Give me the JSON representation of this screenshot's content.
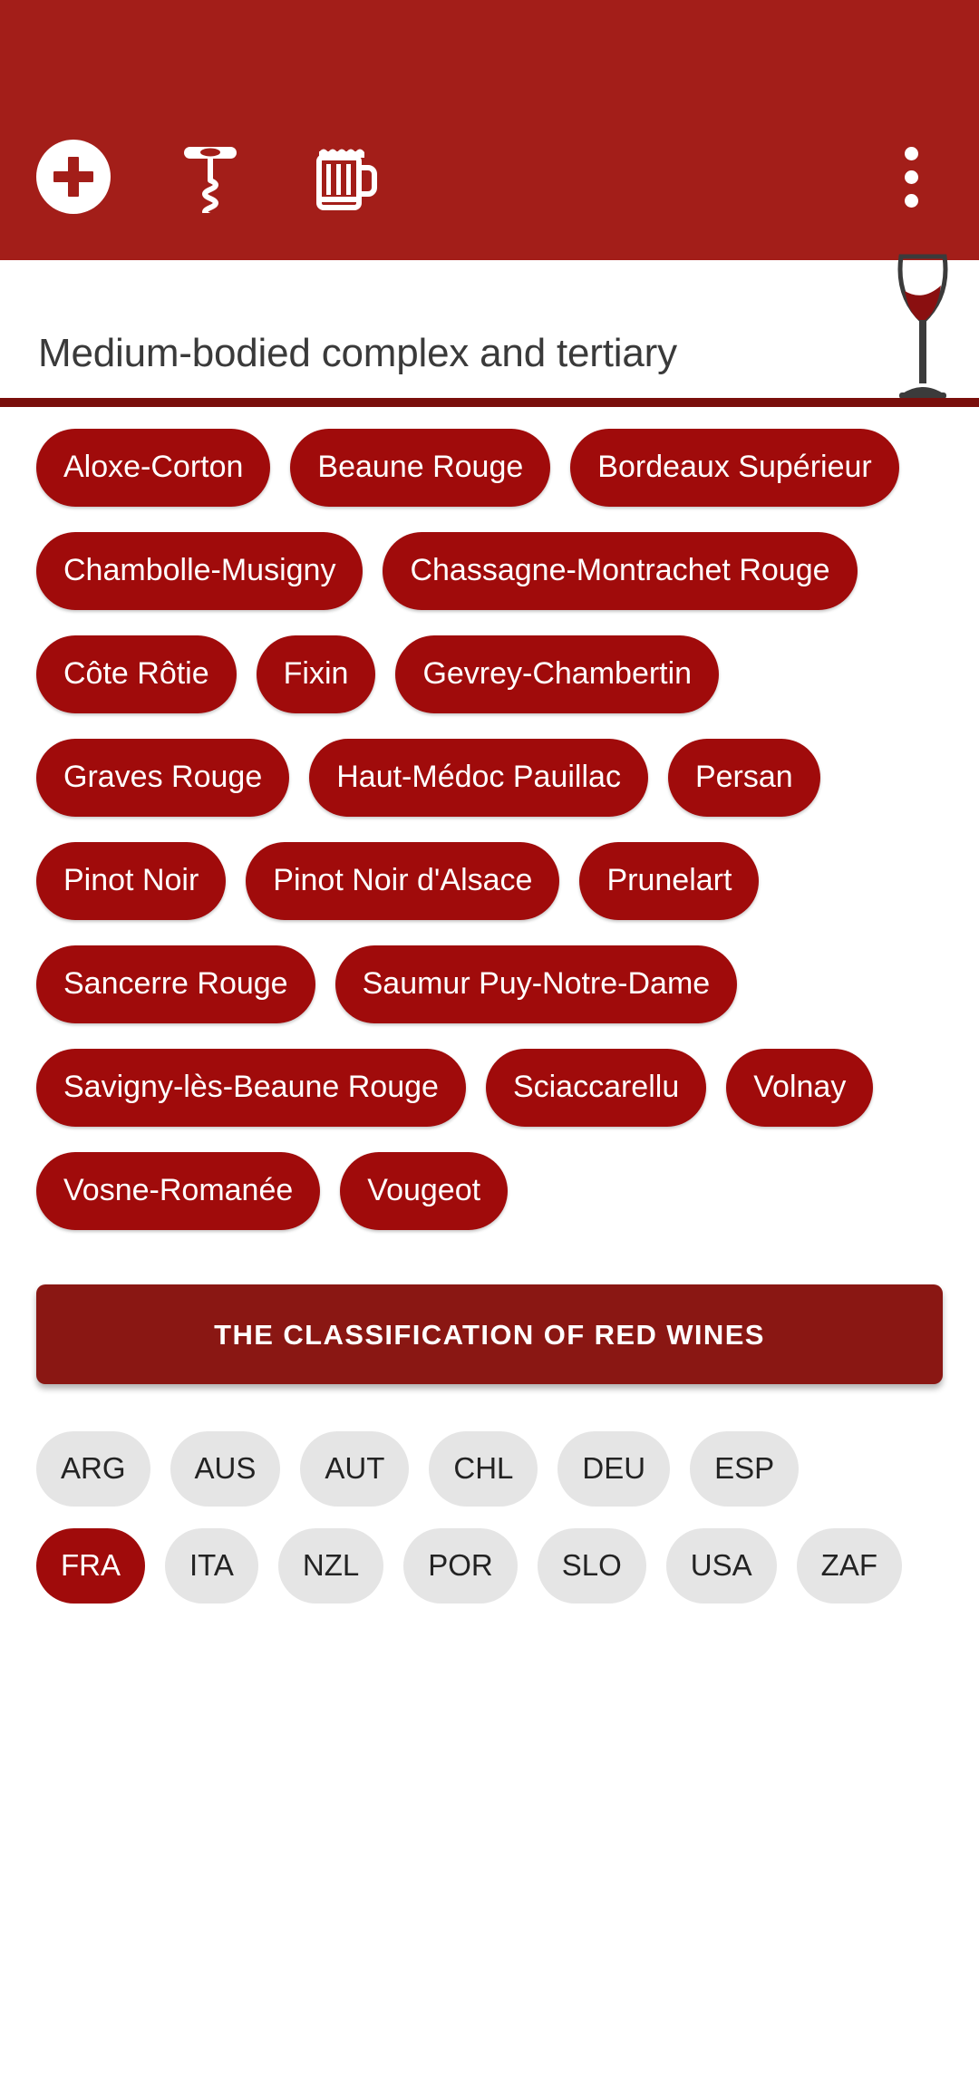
{
  "appbar": {
    "background_color": "#A31E19",
    "actions": [
      {
        "id": "add",
        "icon": "plus-circle-icon",
        "label": "Add"
      },
      {
        "id": "corkscrew",
        "icon": "corkscrew-icon",
        "label": "Wines"
      },
      {
        "id": "beer",
        "icon": "beer-mug-icon",
        "label": "Beers"
      }
    ],
    "overflow_label": "More options"
  },
  "header": {
    "title": "Medium-bodied complex and tertiary",
    "icon": "wine-glass-icon",
    "accent_color": "#7A0F0C"
  },
  "appellations": {
    "chip_color": "#A00B0B",
    "items": [
      "Aloxe-Corton",
      "Beaune Rouge",
      "Bordeaux Supérieur",
      "Chambolle-Musigny",
      "Chassagne-Montrachet Rouge",
      "Côte Rôtie",
      "Fixin",
      "Gevrey-Chambertin",
      "Graves Rouge",
      "Haut-Médoc Pauillac",
      "Persan",
      "Pinot Noir",
      "Pinot Noir d'Alsace",
      "Prunelart",
      "Sancerre Rouge",
      "Saumur Puy-Notre-Dame",
      "Savigny-lès-Beaune Rouge",
      "Sciaccarellu",
      "Volnay",
      "Vosne-Romanée",
      "Vougeot"
    ]
  },
  "section_button": {
    "label": "THE CLASSIFICATION OF RED WINES",
    "color": "#8A1713"
  },
  "countries": {
    "selected": "FRA",
    "chip_color": "#E5E5E5",
    "selected_color": "#A00B0B",
    "items": [
      "ARG",
      "AUS",
      "AUT",
      "CHL",
      "DEU",
      "ESP",
      "FRA",
      "ITA",
      "NZL",
      "POR",
      "SLO",
      "USA",
      "ZAF"
    ]
  }
}
